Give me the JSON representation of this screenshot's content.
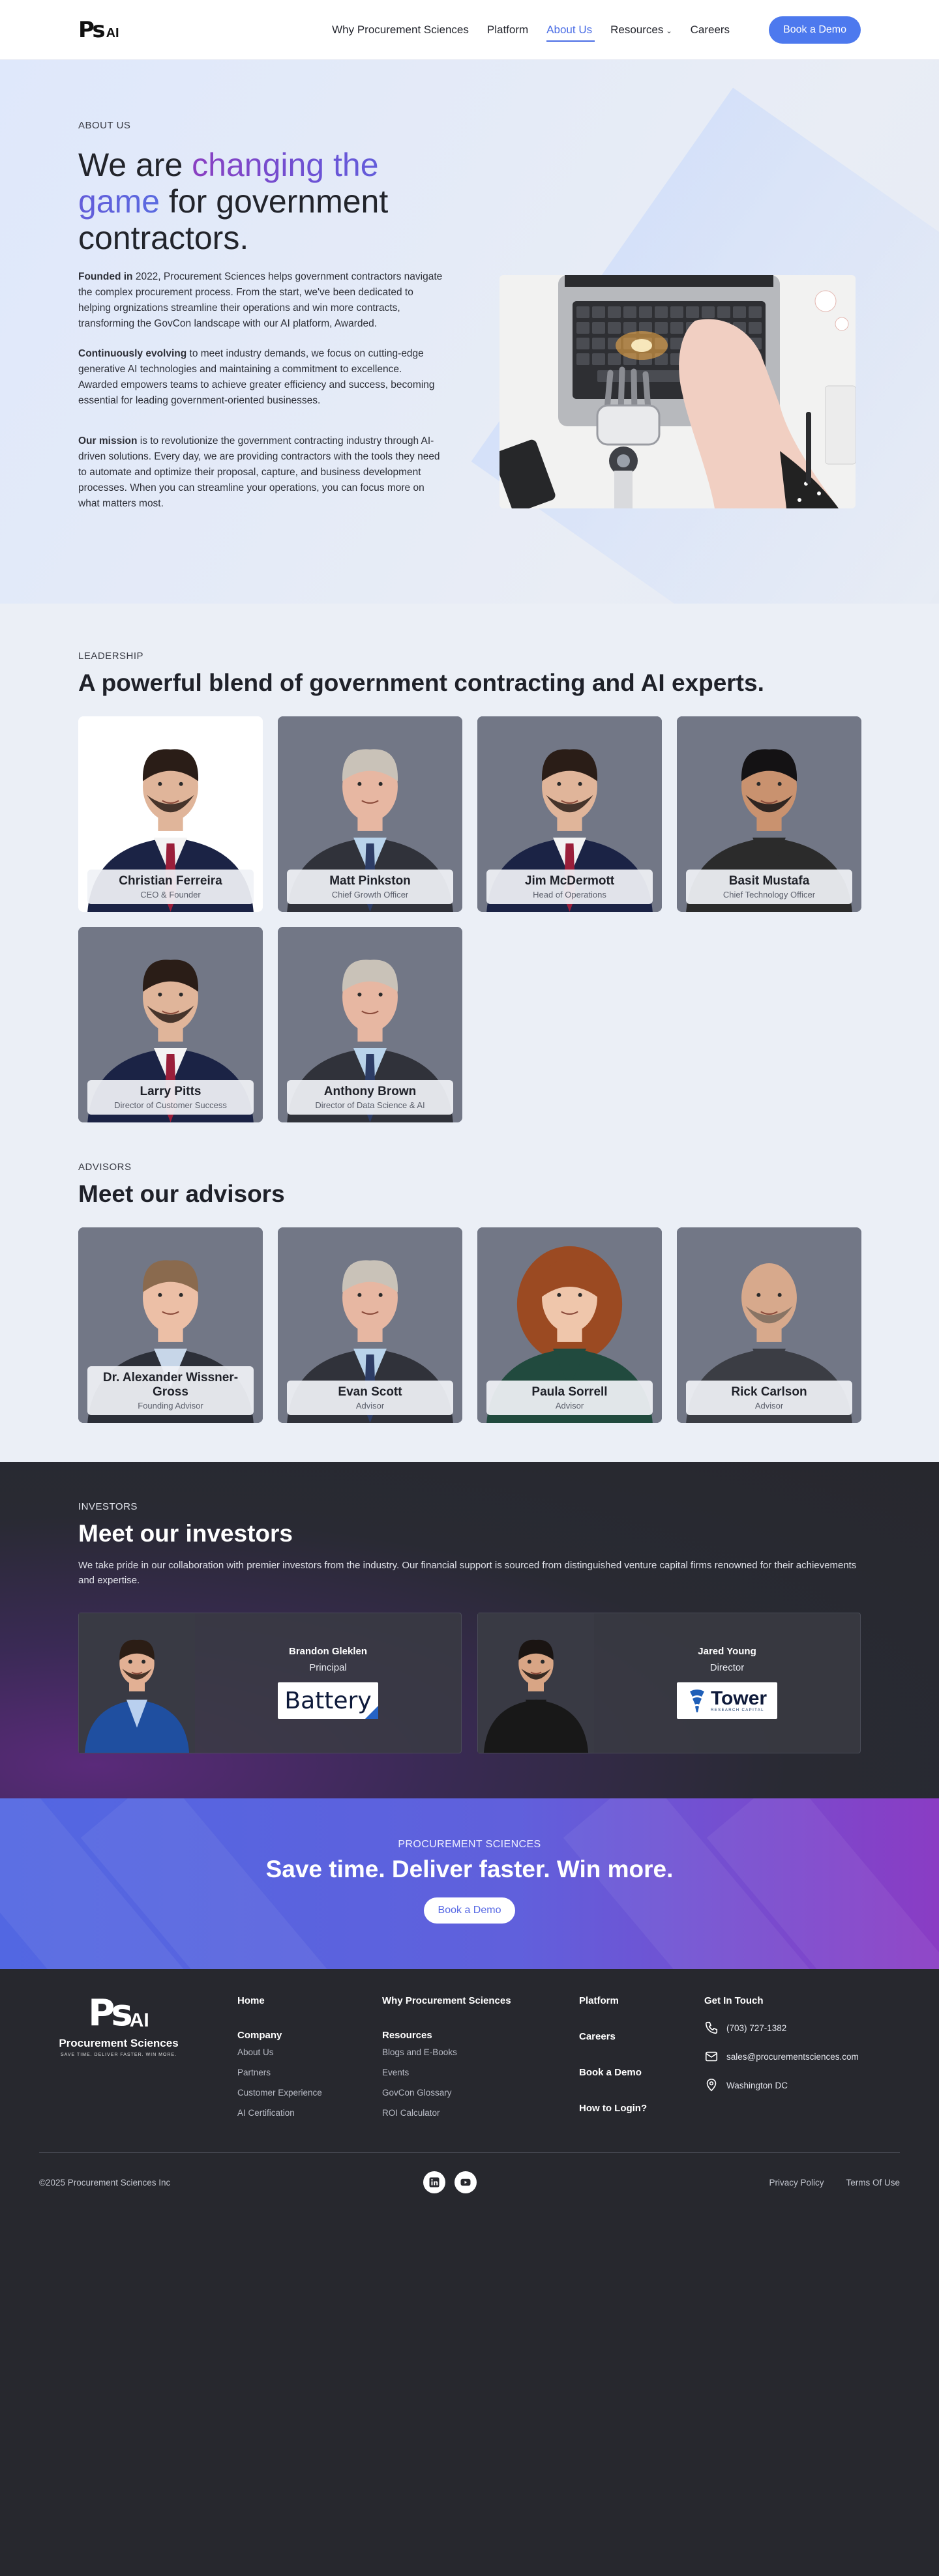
{
  "nav": {
    "logo_alt": "Procurement Sciences AI",
    "links": [
      "Why Procurement Sciences",
      "Platform",
      "About Us",
      "Resources",
      "Careers"
    ],
    "cta": "Book a Demo"
  },
  "hero": {
    "eyebrow": "ABOUT US",
    "title_pre": "We are ",
    "title_highlight": "changing the game",
    "title_post": " for government contractors.",
    "p1_bold": "Founded in",
    "p1": " 2022, Procurement Sciences helps government contractors navigate the complex procurement process. From the start, we've been dedicated to helping orgnizations streamline their operations and win more contracts, transforming the GovCon landscape with our AI platform, Awarded.",
    "p2_bold": "Continuously evolving",
    "p2": " to meet industry demands, we focus on cutting-edge generative AI technologies and maintaining a commitment to excellence. Awarded empowers teams to achieve greater efficiency and success, becoming essential for leading government-oriented businesses.",
    "p3_bold": "Our mission",
    "p3": " is to revolutionize the government contracting industry through AI-driven solutions. Every day, we are providing contractors with the tools they need to automate and optimize their proposal, capture, and business development processes. When you can streamline your operations, you can focus more on what matters most."
  },
  "leadership": {
    "eyebrow": "LEADERSHIP",
    "title": "A powerful blend of government contracting and AI experts.",
    "people": [
      {
        "name": "Christian Ferreira",
        "role": "CEO & Founder"
      },
      {
        "name": "Matt Pinkston",
        "role": "Chief Growth Officer"
      },
      {
        "name": "Jim McDermott",
        "role": "Head of Operations"
      },
      {
        "name": "Basit Mustafa",
        "role": "Chief Technology Officer"
      },
      {
        "name": "Larry Pitts",
        "role": "Director of Customer Success"
      },
      {
        "name": "Anthony Brown",
        "role": "Director of Data Science & AI"
      }
    ]
  },
  "advisors": {
    "eyebrow": "ADVISORS",
    "title": "Meet our advisors",
    "people": [
      {
        "name": "Dr. Alexander Wissner-Gross",
        "role": "Founding Advisor"
      },
      {
        "name": "Evan Scott",
        "role": "Advisor"
      },
      {
        "name": "Paula Sorrell",
        "role": "Advisor"
      },
      {
        "name": "Rick Carlson",
        "role": "Advisor"
      }
    ]
  },
  "investors": {
    "eyebrow": "INVESTORS",
    "title": "Meet our investors",
    "intro": "We take pride in our collaboration with premier investors from the industry. Our financial support is sourced from distinguished venture capital firms renowned for their achievements and expertise.",
    "people": [
      {
        "name": "Brandon Gleklen",
        "title": "Principal",
        "firm": "Battery"
      },
      {
        "name": "Jared Young",
        "title": "Director",
        "firm": "Tower",
        "firm_sub": "RESEARCH CAPITAL"
      }
    ]
  },
  "cta": {
    "sup": "PROCUREMENT SCIENCES",
    "title": "Save time. Deliver faster. Win more.",
    "button": "Book a Demo"
  },
  "footer": {
    "brand_name": "Procurement Sciences",
    "brand_tag": "SAVE TIME. DELIVER FASTER. WIN MORE.",
    "home": "Home",
    "company": "Company",
    "company_links": [
      "About Us",
      "Partners",
      "Customer Experience",
      "AI Certification"
    ],
    "why": "Why Procurement Sciences",
    "resources": "Resources",
    "resources_links": [
      "Blogs and E-Books",
      "Events",
      "GovCon Glossary",
      "ROI Calculator"
    ],
    "platform": "Platform",
    "careers": "Careers",
    "book_demo": "Book a Demo",
    "login": "How to Login?",
    "touch": "Get In Touch",
    "phone": "(703) 727-1382",
    "email": "sales@procurementsciences.com",
    "location": "Washington DC",
    "copyright": "©2025 Procurement Sciences Inc",
    "privacy": "Privacy Policy",
    "terms": "Terms Of Use"
  },
  "colors": {
    "accent": "#4d79ee",
    "dark": "#27282e",
    "light_bg": "#ebeff6",
    "purple": "#8a3cc4"
  }
}
